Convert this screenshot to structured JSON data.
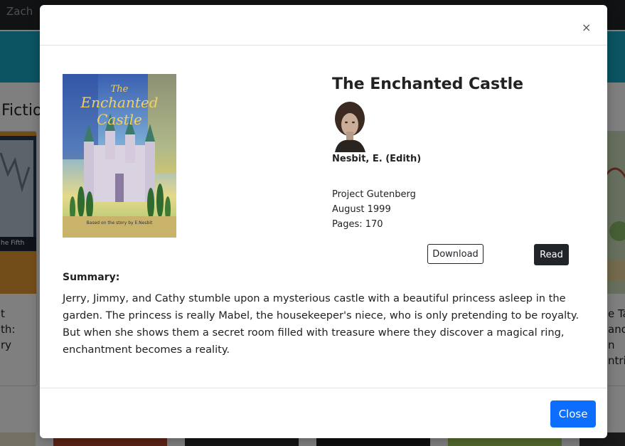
{
  "background": {
    "nav_user": "Zach",
    "section_title": "Fictio",
    "left_card": {
      "cover_caption": "he Fifth",
      "text_lines": [
        "t",
        "th:",
        "ry"
      ]
    },
    "right_card": {
      "text_lines": [
        "e Ta",
        "and",
        "n",
        "ntrix"
      ]
    }
  },
  "modal": {
    "close_icon_glyph": "×",
    "book": {
      "title": "The Enchanted Castle",
      "cover_title_line1": "The",
      "cover_title_line2": "Enchanted",
      "cover_title_line3": "Castle",
      "cover_credit": "Based on the story by E.Nesbit"
    },
    "author": {
      "name": "Nesbit, E. (Edith)"
    },
    "meta": {
      "publisher": "Project Gutenberg",
      "date": "August 1999",
      "pages": "Pages: 170"
    },
    "buttons": {
      "download": "Download",
      "read": "Read",
      "close": "Close"
    },
    "summary": {
      "label": "Summary:",
      "text": "Jerry, Jimmy, and Cathy stumble upon a mysterious castle with a beautiful princess asleep in the garden. The princess is really Mabel, the housekeeper's niece, who is only pretending to be royalty. But when she shows them a secret room filled with treasure where they discover a magical ring, enchantment becomes a reality."
    }
  },
  "colors": {
    "primary": "#0d6efd",
    "dark": "#212529",
    "teal": "#17a9c4"
  }
}
